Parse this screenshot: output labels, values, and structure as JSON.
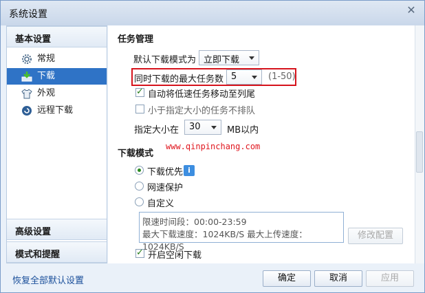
{
  "window": {
    "title": "系统设置",
    "close_glyph": "✕"
  },
  "sidebar": {
    "group_basic": "基本设置",
    "items": [
      {
        "label": "常规",
        "icon": "gear-icon",
        "active": false
      },
      {
        "label": "下载",
        "icon": "download-icon",
        "active": true
      },
      {
        "label": "外观",
        "icon": "shirt-icon",
        "active": false
      },
      {
        "label": "远程下载",
        "icon": "remote-icon",
        "active": false
      }
    ],
    "group_advanced": "高级设置",
    "group_mode": "模式和提醒"
  },
  "task": {
    "section_title": "任务管理",
    "default_mode_label": "默认下载模式为",
    "default_mode_value": "立即下载",
    "max_tasks_label": "同时下载的最大任务数",
    "max_tasks_value": "5",
    "max_tasks_range": "(1-50)",
    "auto_move_label": "自动将低速任务移动至列尾",
    "auto_move_checked": true,
    "no_queue_label": "小于指定大小的任务不排队",
    "no_queue_checked": false,
    "size_prefix": "指定大小在",
    "size_value": "30",
    "size_suffix": "MB以内"
  },
  "watermark": "www.qinpinchang.com",
  "mode": {
    "section_title": "下载模式",
    "options": [
      {
        "label": "下载优先",
        "checked": true
      },
      {
        "label": "网速保护",
        "checked": false
      },
      {
        "label": "自定义",
        "checked": false
      }
    ],
    "info_icon": "i",
    "schedule_line": "限速时间段：00:00-23:59",
    "speed_line": "最大下载速度：1024KB/S  最大上传速度：1024KB/S",
    "modify_button": "修改配置",
    "idle_label": "开启空闲下载",
    "idle_checked": true
  },
  "footer": {
    "restore_link": "恢复全部默认设置",
    "ok": "确定",
    "cancel": "取消",
    "apply": "应用"
  }
}
